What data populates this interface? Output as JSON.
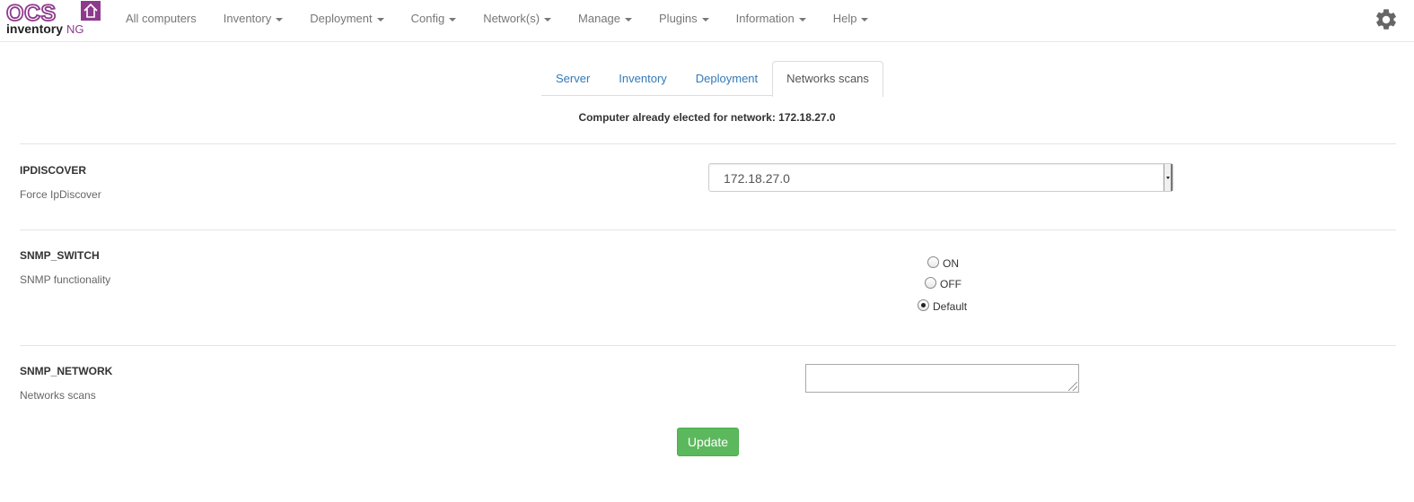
{
  "logo": {
    "top": "OCS",
    "bottom": "inventory",
    "suffix": "NG",
    "brand_color": "#8e3a8c"
  },
  "nav": {
    "items": [
      {
        "label": "All computers",
        "dropdown": false
      },
      {
        "label": "Inventory",
        "dropdown": true
      },
      {
        "label": "Deployment",
        "dropdown": true
      },
      {
        "label": "Config",
        "dropdown": true
      },
      {
        "label": "Network(s)",
        "dropdown": true
      },
      {
        "label": "Manage",
        "dropdown": true
      },
      {
        "label": "Plugins",
        "dropdown": true
      },
      {
        "label": "Information",
        "dropdown": true
      },
      {
        "label": "Help",
        "dropdown": true
      }
    ],
    "settings_icon": "gear-icon"
  },
  "tabs": [
    {
      "label": "Server",
      "active": false
    },
    {
      "label": "Inventory",
      "active": false
    },
    {
      "label": "Deployment",
      "active": false
    },
    {
      "label": "Networks scans",
      "active": true
    }
  ],
  "elected_message": "Computer already elected for network: 172.18.27.0",
  "options": {
    "ipdiscover": {
      "name": "IPDISCOVER",
      "description": "Force IpDiscover",
      "selected": "172.18.27.0"
    },
    "snmp_switch": {
      "name": "SNMP_SWITCH",
      "description": "SNMP functionality",
      "choices": [
        {
          "label": "ON",
          "checked": false
        },
        {
          "label": "OFF",
          "checked": false
        },
        {
          "label": "Default",
          "checked": true
        }
      ]
    },
    "snmp_network": {
      "name": "SNMP_NETWORK",
      "description": "Networks scans",
      "value": ""
    }
  },
  "update_button": {
    "label": "Update",
    "color": "#5cb85c"
  }
}
